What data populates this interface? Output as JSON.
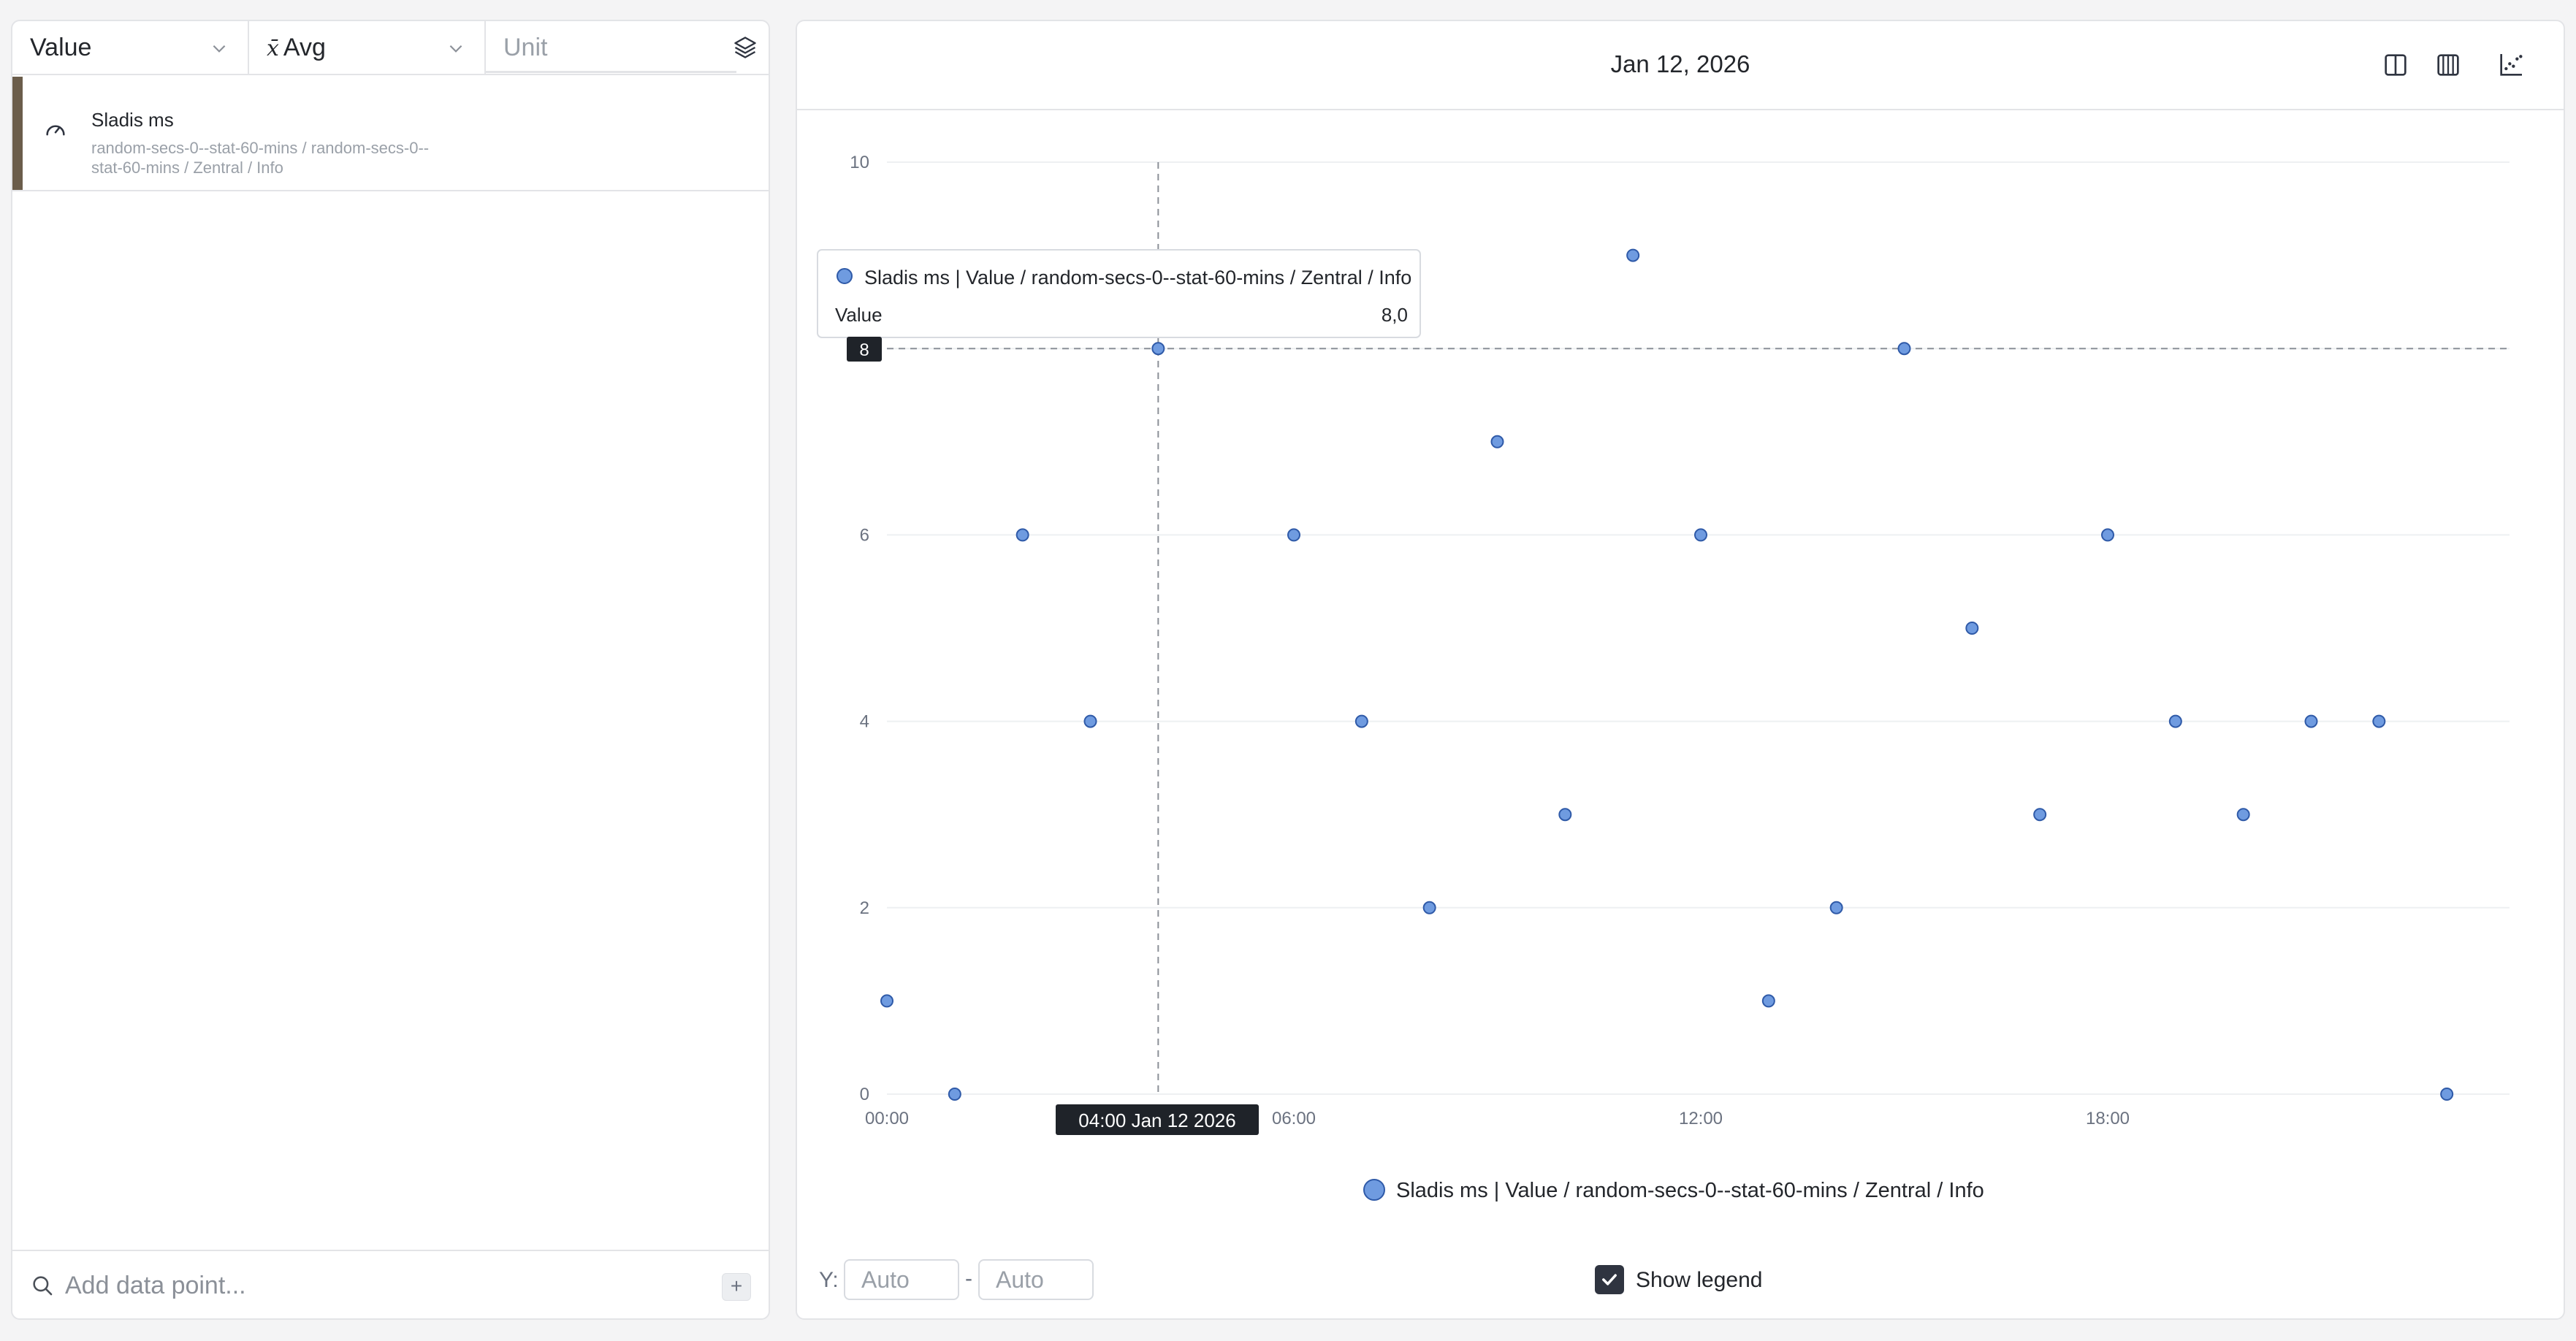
{
  "selectors": {
    "value": "Value",
    "aggregation": "Avg",
    "unit_placeholder": "Unit"
  },
  "data_point": {
    "title": "Sladis ms",
    "path": "random-secs-0--stat-60-mins / random-secs-0--stat-60-mins / Zentral / Info",
    "color": "#6b5d4b"
  },
  "add_data_point": {
    "placeholder": "Add data point...",
    "plus": "+"
  },
  "header": {
    "title": "Jan 12, 2026"
  },
  "tooltip": {
    "series": "Sladis ms | Value / random-secs-0--stat-60-mins / Zentral / Info",
    "label": "Value",
    "value": "8,0",
    "x_badge": "04:00 Jan 12 2026",
    "y_badge": "8"
  },
  "controls": {
    "y_label": "Y:",
    "y_min_placeholder": "Auto",
    "y_sep": "-",
    "y_max_placeholder": "Auto",
    "show_legend_label": "Show legend",
    "show_legend_checked": true
  },
  "chart_data": {
    "type": "scatter",
    "title": "Jan 12, 2026",
    "xlabel": "",
    "ylabel": "",
    "x_ticks": [
      "00:00",
      "06:00",
      "12:00",
      "18:00"
    ],
    "y_ticks": [
      0,
      2,
      4,
      6,
      8,
      10
    ],
    "ylim": [
      0,
      10
    ],
    "xlim_hours": [
      0,
      23.75
    ],
    "grid": true,
    "legend_position": "bottom",
    "series": [
      {
        "name": "Sladis ms | Value / random-secs-0--stat-60-mins / Zentral / Info",
        "color": "#6f9be0",
        "points": [
          {
            "x": "00:00",
            "y": 1
          },
          {
            "x": "01:00",
            "y": 0
          },
          {
            "x": "02:00",
            "y": 6
          },
          {
            "x": "03:00",
            "y": 4
          },
          {
            "x": "04:00",
            "y": 8
          },
          {
            "x": "06:00",
            "y": 6
          },
          {
            "x": "07:00",
            "y": 4
          },
          {
            "x": "08:00",
            "y": 2
          },
          {
            "x": "09:00",
            "y": 7
          },
          {
            "x": "10:00",
            "y": 3
          },
          {
            "x": "11:00",
            "y": 9
          },
          {
            "x": "12:00",
            "y": 6
          },
          {
            "x": "13:00",
            "y": 1
          },
          {
            "x": "14:00",
            "y": 2
          },
          {
            "x": "15:00",
            "y": 8
          },
          {
            "x": "16:00",
            "y": 5
          },
          {
            "x": "17:00",
            "y": 3
          },
          {
            "x": "18:00",
            "y": 6
          },
          {
            "x": "19:00",
            "y": 4
          },
          {
            "x": "20:00",
            "y": 3
          },
          {
            "x": "21:00",
            "y": 4
          },
          {
            "x": "22:00",
            "y": 4
          },
          {
            "x": "23:00",
            "y": 0
          }
        ]
      }
    ],
    "crosshair": {
      "x": "04:00",
      "y": 8
    }
  }
}
